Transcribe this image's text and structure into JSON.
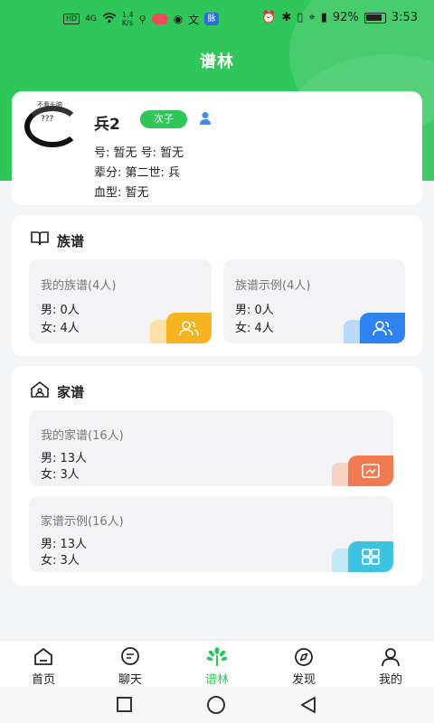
{
  "status_bar": {
    "hd": "HD",
    "net": "4G",
    "speed_value": "1.4",
    "speed_unit": "K/s",
    "badge": "脉",
    "wen": "文",
    "battery": "92%",
    "time": "3:53"
  },
  "title": "谱林",
  "profile": {
    "avatar_caption": "不看头脑",
    "avatar_mark": "???",
    "name": "兵2",
    "rank": "次子",
    "line1": "号: 暂无    号: 暂无",
    "line2": "辈分: 第二世:  兵",
    "line3": "血型: 暂无"
  },
  "zupu": {
    "title": "族谱",
    "cards": [
      {
        "title": "我的族谱(4人)",
        "male": "男: 0人",
        "female": "女: 4人"
      },
      {
        "title": "族谱示例(4人)",
        "male": "男: 0人",
        "female": "女: 4人"
      }
    ]
  },
  "jiapu": {
    "title": "家谱",
    "cards": [
      {
        "title": "我的家谱(16人)",
        "male": "男: 13人",
        "female": "女: 3人"
      },
      {
        "title": "家谱示例(16人)",
        "male": "男: 13人",
        "female": "女: 3人"
      }
    ]
  },
  "tabs": [
    {
      "label": "首页",
      "icon": "home-icon"
    },
    {
      "label": "聊天",
      "icon": "chat-icon"
    },
    {
      "label": "谱林",
      "icon": "tree-icon"
    },
    {
      "label": "发现",
      "icon": "compass-icon"
    },
    {
      "label": "我的",
      "icon": "user-icon"
    }
  ],
  "colors": {
    "accent": "#2fc65a",
    "tile_orange": "#f7b21f",
    "tile_blue": "#2f83f0",
    "tile_coral": "#f07b52",
    "tile_cyan": "#3cc3e2"
  }
}
